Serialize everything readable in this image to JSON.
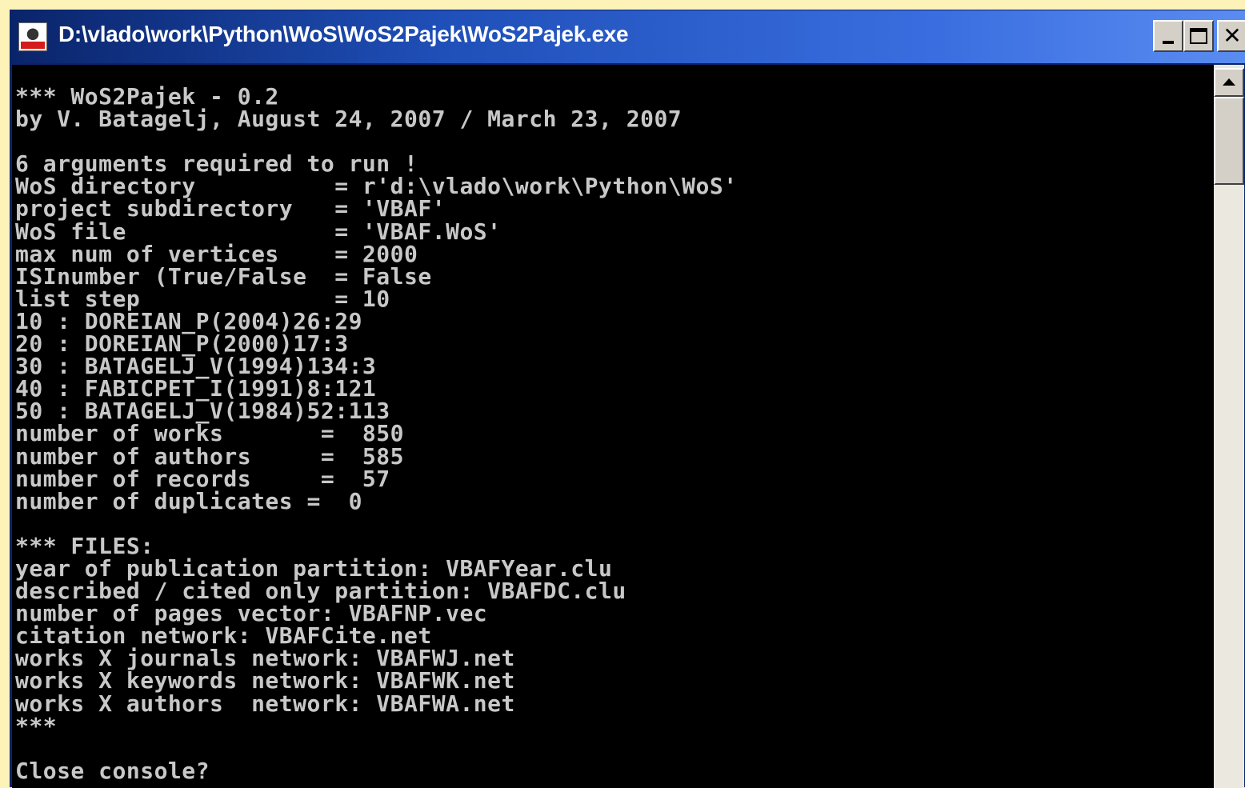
{
  "window": {
    "title": "D:\\vlado\\work\\Python\\WoS\\WoS2Pajek\\WoS2Pajek.exe",
    "icon": "pajek-app-icon",
    "buttons": {
      "minimize": "minimize-icon",
      "maximize": "maximize-icon",
      "close": "close-icon"
    },
    "colors": {
      "titlebar_start": "#0a246a",
      "titlebar_end": "#5a8cf0",
      "console_bg": "#000000",
      "console_fg": "#c8c8c8"
    }
  },
  "console": {
    "lines": [
      "*** WoS2Pajek - 0.2",
      "by V. Batagelj, August 24, 2007 / March 23, 2007",
      "",
      "6 arguments required to run !",
      "WoS directory          = r'd:\\vlado\\work\\Python\\WoS'",
      "project subdirectory   = 'VBAF'",
      "WoS file               = 'VBAF.WoS'",
      "max num of vertices    = 2000",
      "ISInumber (True/False  = False",
      "list step              = 10",
      "10 : DOREIAN_P(2004)26:29",
      "20 : DOREIAN_P(2000)17:3",
      "30 : BATAGELJ_V(1994)134:3",
      "40 : FABICPET_I(1991)8:121",
      "50 : BATAGELJ_V(1984)52:113",
      "number of works       =  850",
      "number of authors     =  585",
      "number of records     =  57",
      "number of duplicates =  0",
      "",
      "*** FILES:",
      "year of publication partition: VBAFYear.clu",
      "described / cited only partition: VBAFDC.clu",
      "number of pages vector: VBAFNP.vec",
      "citation network: VBAFCite.net",
      "works X journals network: VBAFWJ.net",
      "works X keywords network: VBAFWK.net",
      "works X authors  network: VBAFWA.net",
      "***",
      "",
      "Close console?"
    ]
  },
  "scrollbar": {
    "up_icon": "scroll-up-arrow-icon"
  }
}
